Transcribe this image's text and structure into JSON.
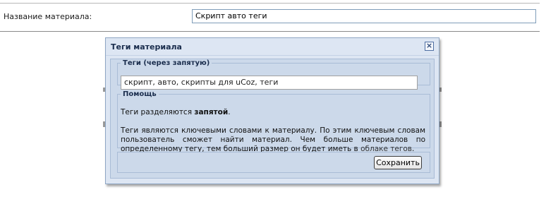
{
  "form": {
    "title_label": "Название материала:",
    "title_value": "Скрипт авто теги"
  },
  "dialog": {
    "title": "Теги материала",
    "close_icon": "close-icon",
    "tags_section": {
      "legend": "Теги (через запятую)",
      "value": "скрипт, авто, скрипты для uCoz, теги"
    },
    "help_section": {
      "legend": "Помощь",
      "line1_prefix": "Теги разделяются ",
      "line1_bold": "запятой",
      "line1_suffix": ".",
      "para_text": "Теги являются ключевыми словами к материалу. По этим ключевым словам пользователь сможет найти материал. Чем больше материалов по определенному тегу, тем больший размер он будет иметь в ",
      "para_link": "облаке тегов",
      "para_end": "."
    },
    "save_label": "Сохранить"
  }
}
